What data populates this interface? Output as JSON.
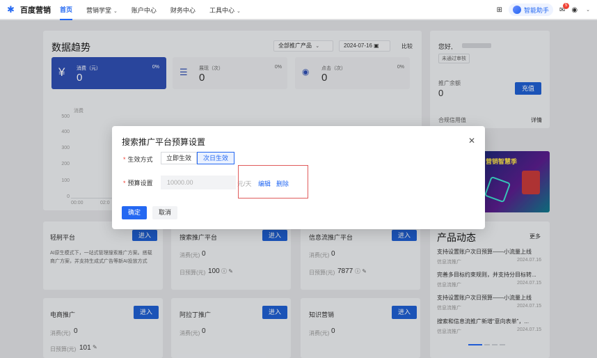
{
  "brand": {
    "name": "百度营销"
  },
  "nav": {
    "items": [
      {
        "label": "首页",
        "active": true
      },
      {
        "label": "营销学堂",
        "dropdown": true
      },
      {
        "label": "账户中心"
      },
      {
        "label": "财务中心"
      },
      {
        "label": "工具中心",
        "dropdown": true
      }
    ]
  },
  "toolbar": {
    "ai_label": "智能助手",
    "notify_count": "5"
  },
  "trend": {
    "title": "数据趋势",
    "product_select": "全部推广产品",
    "date": "2024-07-16",
    "compare": "比较",
    "stats": [
      {
        "label": "消费（元）",
        "pct": "0%",
        "value": "0",
        "icon": "yen-icon"
      },
      {
        "label": "展现（次）",
        "pct": "0%",
        "value": "0",
        "icon": "impression-icon"
      },
      {
        "label": "点击（次）",
        "pct": "0%",
        "value": "0",
        "icon": "click-icon"
      }
    ],
    "ylabel": "消费",
    "yticks": [
      "500",
      "400",
      "300",
      "200",
      "100",
      "0"
    ],
    "xticks": [
      "00:00",
      "02:0"
    ]
  },
  "account": {
    "greeting": "您好,",
    "status": "未通过审核",
    "balance_label": "推广余额",
    "balance": "0",
    "recharge": "充值",
    "credit_label": "合规信用值",
    "detail": "详情"
  },
  "modal": {
    "title": "搜索推广平台预算设置",
    "effect_label": "生效方式",
    "effect_options": [
      "立即生效",
      "次日生效"
    ],
    "effect_selected": "次日生效",
    "budget_label": "预算设置",
    "budget_value": "10000.00",
    "budget_unit": "元/天",
    "edit": "编辑",
    "delete": "删除",
    "ok": "确定",
    "cancel": "取消"
  },
  "products": [
    {
      "name": "轻舸平台",
      "enter": "进入",
      "desc": "AI原生模式下，一站式管理搜索推广方案。搭载商广方案，并支持生成式广告等新AI投放方式"
    },
    {
      "name": "搜索推广平台",
      "enter": "进入",
      "spend_label": "消费(元)",
      "spend": "0",
      "budget_label": "日预算(元)",
      "budget": "100"
    },
    {
      "name": "信息流推广平台",
      "enter": "进入",
      "spend_label": "消费(元)",
      "spend": "0",
      "budget_label": "日预算(元)",
      "budget": "7877"
    },
    {
      "name": "电商推广",
      "enter": "进入",
      "spend_label": "消费(元)",
      "spend": "0",
      "budget_label": "日预算(元)",
      "budget": "101"
    },
    {
      "name": "阿拉丁推广",
      "enter": "进入",
      "spend_label": "消费(元)",
      "spend": "0"
    },
    {
      "name": "知识营销",
      "enter": "进入",
      "spend_label": "消费(元)",
      "spend": "0"
    }
  ],
  "news": {
    "title": "产品动态",
    "more": "更多",
    "items": [
      {
        "title": "支持设置账户次日预算——小流量上线",
        "tag": "信息流推广",
        "date": "2024.07.16"
      },
      {
        "title": "完善多目标约束规则，并支持分目标转...",
        "tag": "信息流推广",
        "date": "2024.07.15"
      },
      {
        "title": "支持设置账户次日预算——小流量上线",
        "tag": "信息流推广",
        "date": "2024.07.15"
      },
      {
        "title": "搜索和信息流推广新增“意向表单”，...",
        "tag": "信息流推广",
        "date": "2024.07.15"
      }
    ]
  },
  "banner": {
    "text": "营销智慧季"
  }
}
